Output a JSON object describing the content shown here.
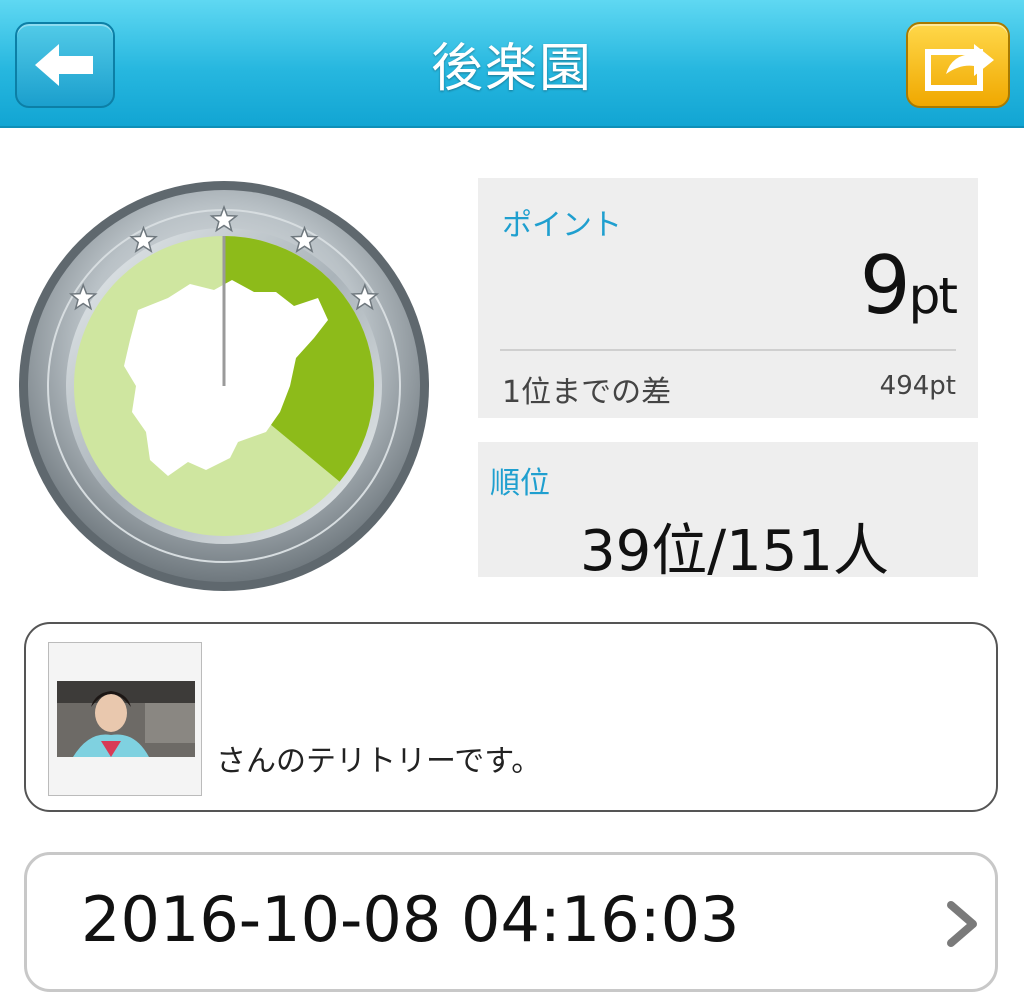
{
  "header": {
    "title": "後楽園",
    "back_icon": "back-arrow-icon",
    "share_icon": "share-icon",
    "accent": "#27b7df",
    "share_color": "#f0a800"
  },
  "badge": {
    "stars": 5,
    "territory_fill_color": "#8dbb1a",
    "territory_bg_color": "#cfe6a0",
    "progress_fraction": 0.36
  },
  "points": {
    "label": "ポイント",
    "value": "9",
    "unit": "pt",
    "diff_label": "1位までの差",
    "diff_value": "494pt"
  },
  "rank": {
    "label": "順位",
    "value": "39位/151人"
  },
  "owner": {
    "name_line": "さんのテリトリーです。"
  },
  "timestamp": {
    "value": "2016-10-08 04:16:03",
    "chevron_icon": "chevron-right-icon"
  }
}
